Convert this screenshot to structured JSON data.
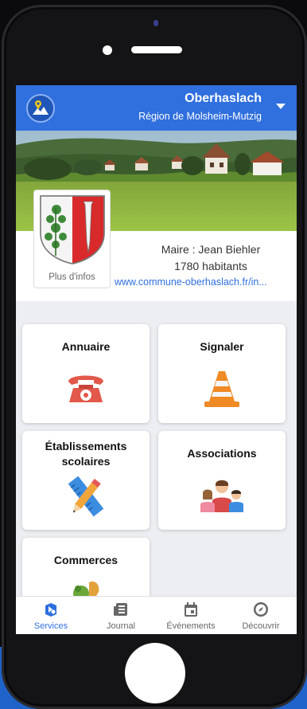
{
  "header": {
    "title": "Oberhaslach",
    "subtitle": "Région de Molsheim-Mutzig",
    "logo_icon": "map-pin-mountain-icon",
    "dropdown_icon": "caret-down-icon"
  },
  "commune": {
    "more_info_label": "Plus d'infos",
    "mayor": "Maire : Jean Biehler",
    "population": "1780 habitants",
    "website": "www.commune-oberhaslach.fr/in..."
  },
  "services": [
    {
      "label": "Annuaire",
      "icon": "telephone-icon"
    },
    {
      "label": "Signaler",
      "icon": "traffic-cone-icon"
    },
    {
      "label": "Établissements scolaires",
      "icon": "pencil-ruler-icon"
    },
    {
      "label": "Associations",
      "icon": "people-group-icon"
    },
    {
      "label": "Commerces",
      "icon": "groceries-icon"
    }
  ],
  "tabs": [
    {
      "label": "Services",
      "icon": "services-icon",
      "active": true
    },
    {
      "label": "Journal",
      "icon": "newspaper-icon",
      "active": false
    },
    {
      "label": "Événements",
      "icon": "calendar-icon",
      "active": false
    },
    {
      "label": "Découvrir",
      "icon": "compass-icon",
      "active": false
    }
  ],
  "colors": {
    "primary": "#2f6fde",
    "background": "#eceef2",
    "phone_body": "#141416"
  }
}
